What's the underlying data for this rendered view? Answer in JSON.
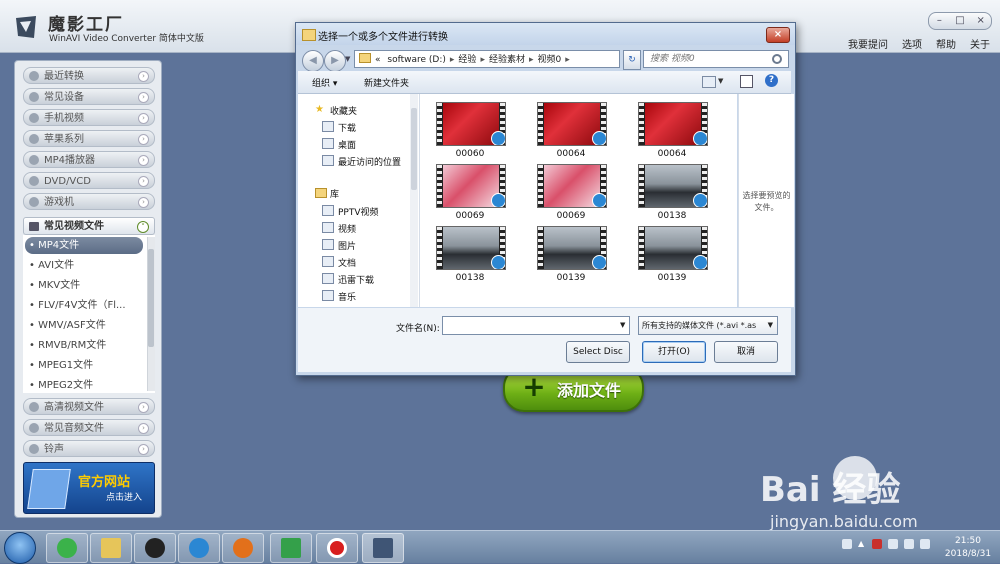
{
  "app": {
    "title": "魔影工厂",
    "subtitle": "WinAVI Video Converter 简体中文版",
    "links": [
      "我要提问",
      "选项",
      "帮助",
      "关于"
    ]
  },
  "sidebar": {
    "categories_top": [
      "最近转换",
      "常见设备",
      "手机视频",
      "苹果系列",
      "MP4播放器",
      "DVD/VCD",
      "游戏机"
    ],
    "open_category": "常见视频文件",
    "sub_items": [
      "• MP4文件",
      "• AVI文件",
      "• MKV文件",
      "• FLV/F4V文件（Fl...",
      "• WMV/ASF文件",
      "• RMVB/RM文件",
      "• MPEG1文件",
      "• MPEG2文件"
    ],
    "selected_index": 0,
    "categories_bottom": [
      "高清视频文件",
      "常见音频文件",
      "铃声"
    ],
    "banner_title": "官方网站",
    "banner_sub": "点击进入"
  },
  "add_file": {
    "label": "添加文件"
  },
  "dialog": {
    "title": "选择一个或多个文件进行转换",
    "address": [
      "software (D:)",
      "经验",
      "经验素材",
      "视频0"
    ],
    "address_prefix": "«",
    "search_placeholder": "搜索 视频0",
    "toolbar": {
      "organize": "组织 ▾",
      "new_folder": "新建文件夹"
    },
    "nav": {
      "favorites_header": "收藏夹",
      "favorites": [
        "下载",
        "桌面",
        "最近访问的位置"
      ],
      "library_header": "库",
      "library": [
        "PPTV视频",
        "视频",
        "图片",
        "文档",
        "迅雷下载",
        "音乐"
      ]
    },
    "files": [
      {
        "name": "00060",
        "scene": "red"
      },
      {
        "name": "00064",
        "scene": "red"
      },
      {
        "name": "00064",
        "scene": "red"
      },
      {
        "name": "00069",
        "scene": "pink"
      },
      {
        "name": "00069",
        "scene": "pink"
      },
      {
        "name": "00138",
        "scene": "car"
      },
      {
        "name": "00138",
        "scene": "car"
      },
      {
        "name": "00139",
        "scene": "car"
      },
      {
        "name": "00139",
        "scene": "car"
      }
    ],
    "preview_text": "选择要预览的文件。",
    "filename_label": "文件名(N):",
    "filename_value": "",
    "filetype_value": "所有支持的媒体文件 (*.avi *.as",
    "btn_select_disc": "Select Disc",
    "btn_open": "打开(O)",
    "btn_cancel": "取消"
  },
  "taskbar": {
    "time": "21:50",
    "date": "2018/8/31"
  },
  "watermark": {
    "logo": "Bai  经验",
    "url": "jingyan.baidu.com"
  }
}
